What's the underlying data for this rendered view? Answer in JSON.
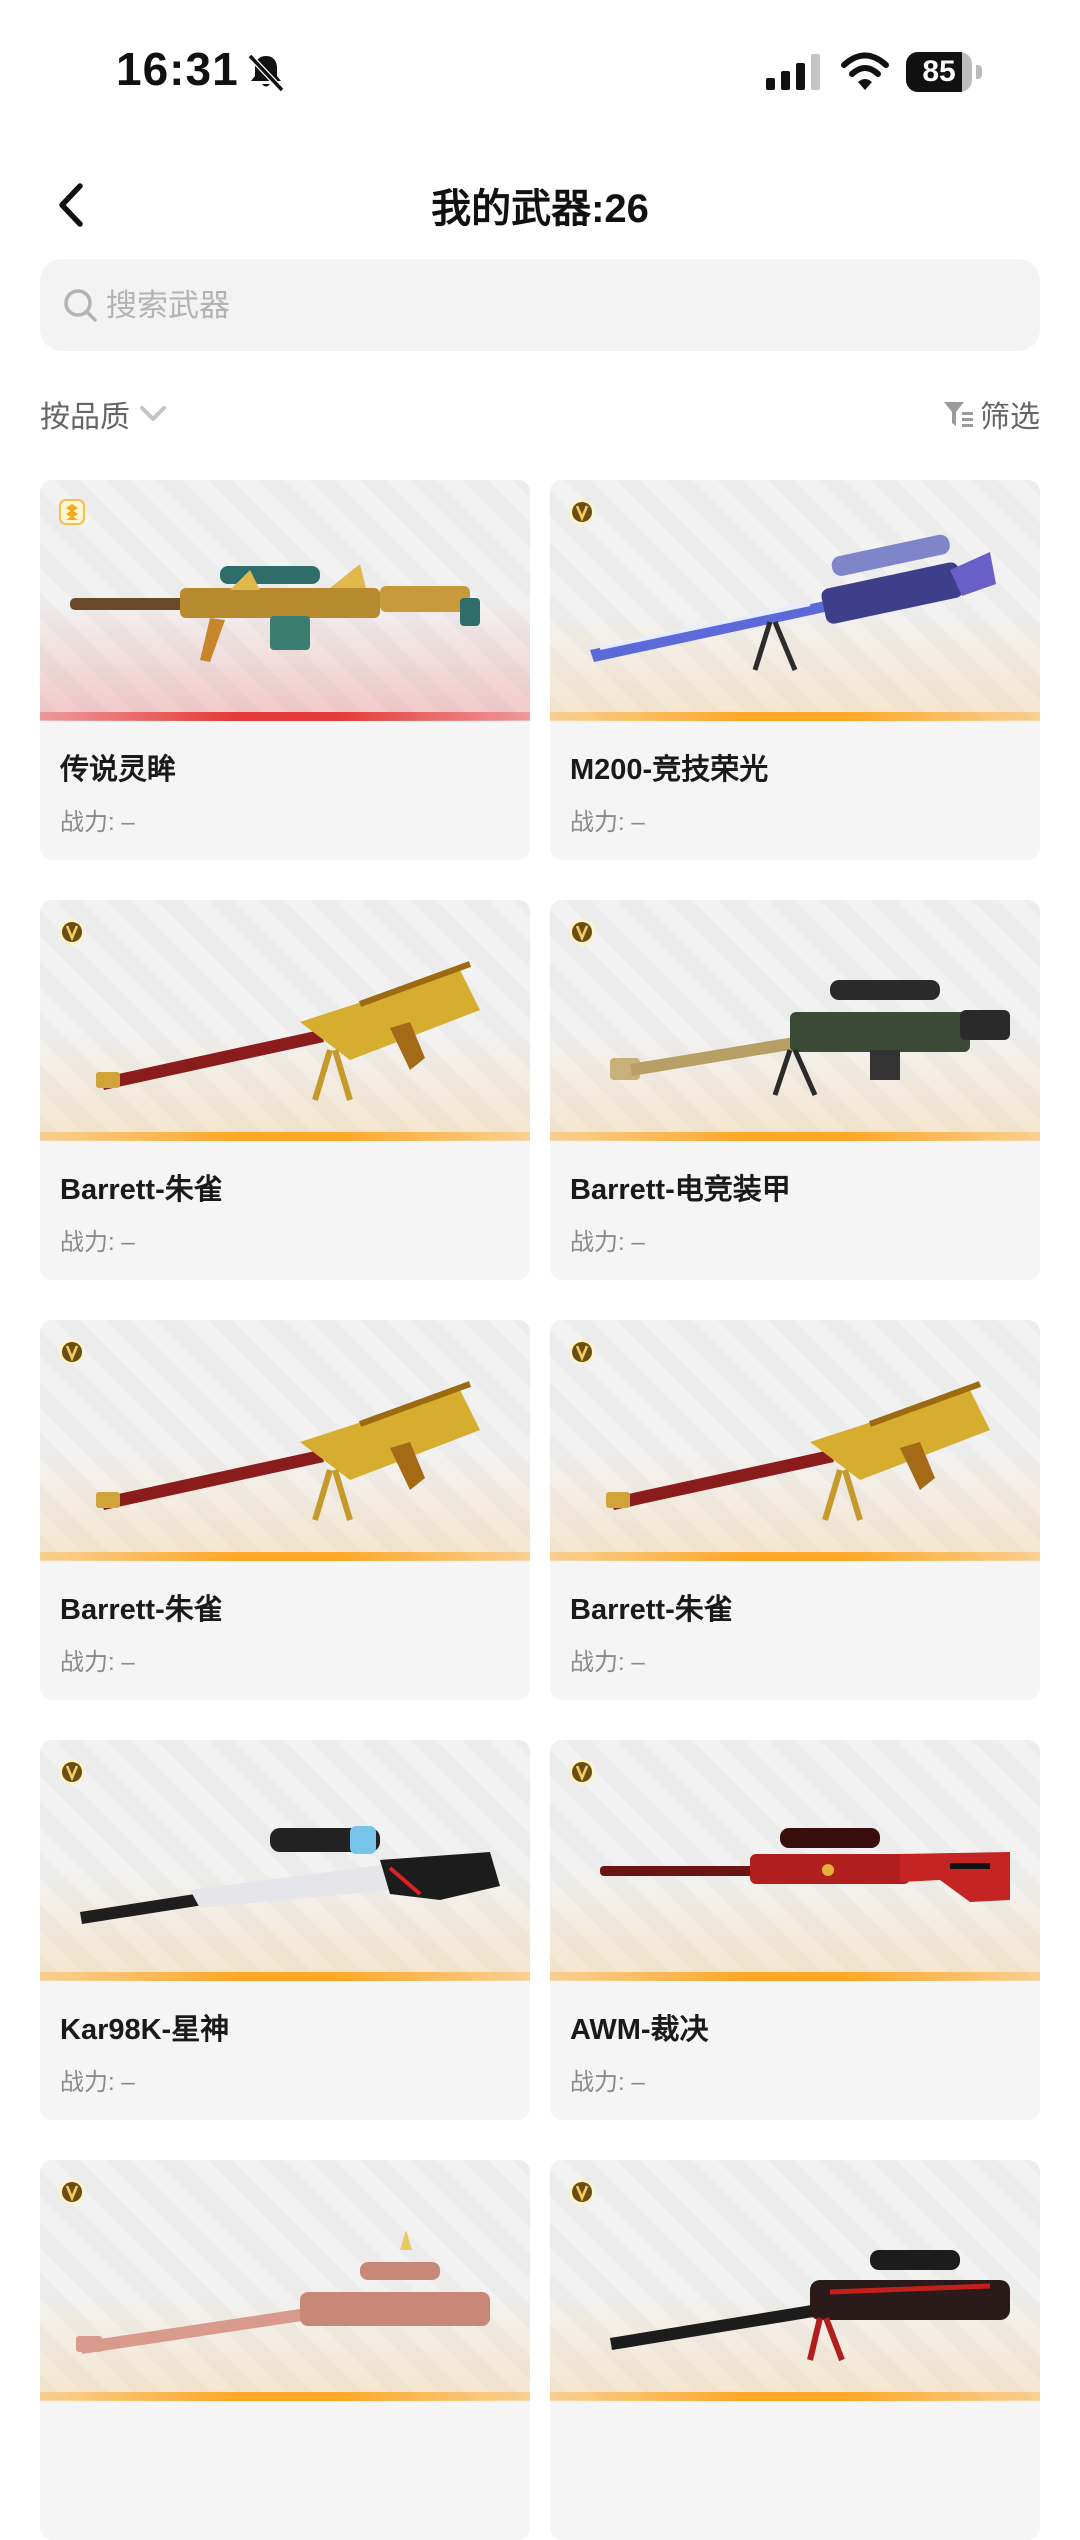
{
  "status_bar": {
    "time": "16:31",
    "battery": "85"
  },
  "header": {
    "title": "我的武器:26"
  },
  "search": {
    "placeholder": "搜索武器"
  },
  "toolbar": {
    "sort_label": "按品质",
    "filter_label": "筛选"
  },
  "weapons": [
    {
      "name": "传说灵眸",
      "power": "战力: –",
      "rarity": "legend",
      "accent": "#e53935"
    },
    {
      "name": "M200-竞技荣光",
      "power": "战力: –",
      "rarity": "v",
      "accent": "#ffa726"
    },
    {
      "name": "Barrett-朱雀",
      "power": "战力: –",
      "rarity": "v",
      "accent": "#ffa726"
    },
    {
      "name": "Barrett-电竞装甲",
      "power": "战力: –",
      "rarity": "v",
      "accent": "#ffa726"
    },
    {
      "name": "Barrett-朱雀",
      "power": "战力: –",
      "rarity": "v",
      "accent": "#ffa726"
    },
    {
      "name": "Barrett-朱雀",
      "power": "战力: –",
      "rarity": "v",
      "accent": "#ffa726"
    },
    {
      "name": "Kar98K-星神",
      "power": "战力: –",
      "rarity": "v",
      "accent": "#ffa726"
    },
    {
      "name": "AWM-裁决",
      "power": "战力: –",
      "rarity": "v",
      "accent": "#ffa726"
    },
    {
      "name": "",
      "power": "",
      "rarity": "v",
      "accent": "#ffa726"
    },
    {
      "name": "",
      "power": "",
      "rarity": "v",
      "accent": "#ffa726"
    }
  ]
}
